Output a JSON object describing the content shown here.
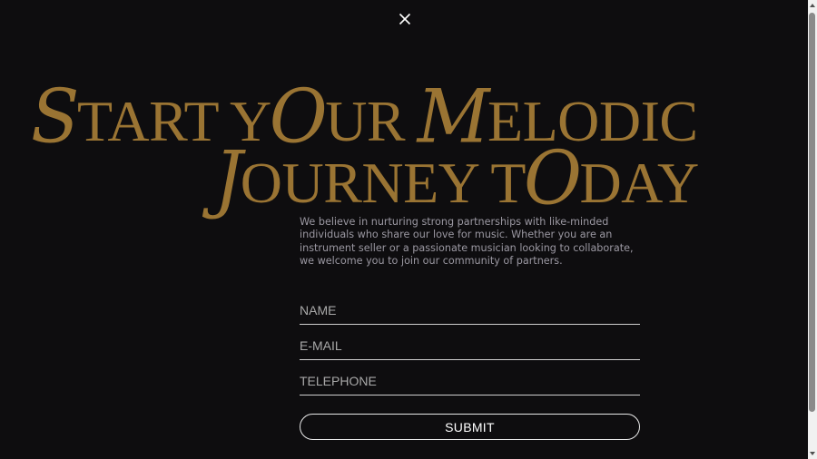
{
  "headline": {
    "line1": {
      "swash1": "S",
      "p1": "TART Y",
      "swash2": "O",
      "p2": "UR ",
      "swash3": "M",
      "p3": "ELODIC"
    },
    "line2": {
      "swash1": "J",
      "p1": "OURNEY T",
      "swash2": "O",
      "p2": "DAY"
    }
  },
  "intro": "We believe in nurturing strong partnerships with like-minded individuals who share our love for music. Whether you are an instrument seller or a passionate musician looking to collaborate, we welcome you to join our community of partners.",
  "form": {
    "name_placeholder": "NAME",
    "email_placeholder": "E-MAIL",
    "telephone_placeholder": "TELEPHONE",
    "submit_label": "SUBMIT"
  },
  "icons": {
    "close": "close-icon"
  },
  "colors": {
    "background": "#0e0d0f",
    "accent_gold": "#9a7433",
    "text_muted": "#9b98a2",
    "line": "#cfcfcf"
  }
}
